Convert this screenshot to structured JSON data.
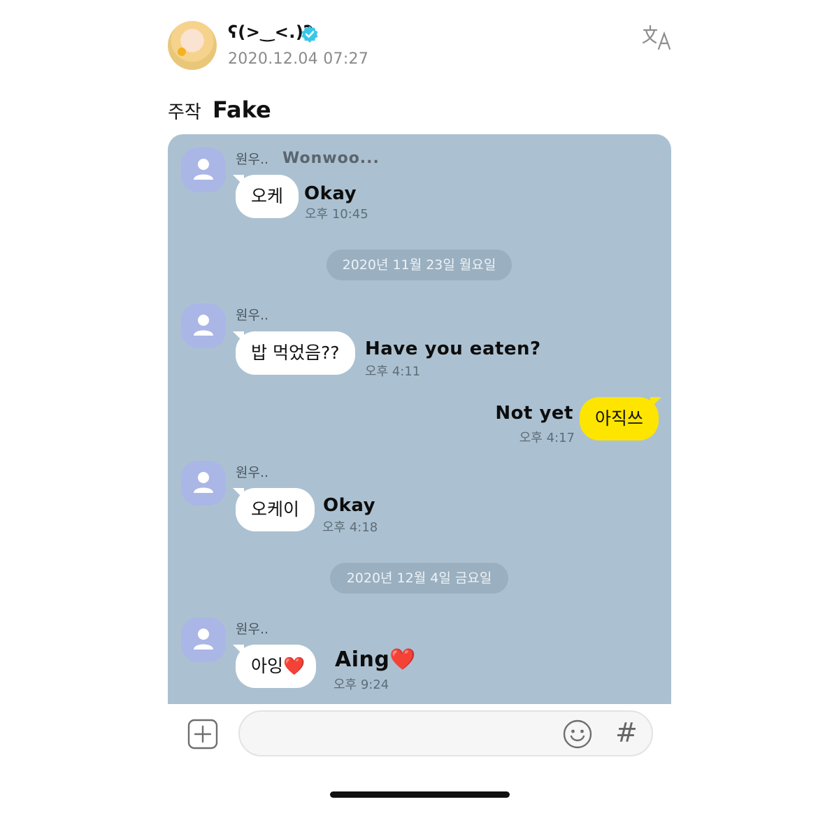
{
  "post": {
    "username": "ʕ(>‿<.)ʔ",
    "timestamp": "2020.12.04 07:27",
    "caption_ko": "주작",
    "caption_en": "Fake"
  },
  "chat": {
    "messages": [
      {
        "sender": "원우..",
        "sender_extra": "Wonwoo...",
        "text": "오케",
        "translation": "Okay",
        "time": "오후 10:45"
      },
      {
        "sender": "원우..",
        "text": "밥 먹었음??",
        "translation": "Have you eaten?",
        "time": "오후 4:11"
      },
      {
        "text": "아직쓰",
        "translation": "Not yet",
        "time": "오후 4:17"
      },
      {
        "sender": "원우..",
        "text": "오케이",
        "translation": "Okay",
        "time": "오후 4:18"
      },
      {
        "sender": "원우..",
        "text": "아잉",
        "translation": "Aing",
        "time": "오후 9:24"
      }
    ],
    "dates": [
      "2020년 11월 23일 월요일",
      "2020년 12월 4일 금요일"
    ],
    "heart_emoji": "❤️"
  },
  "input": {
    "add_icon": "plus-square-icon",
    "emoji_icon": "smiley-icon",
    "hash_label": "#"
  },
  "colors": {
    "chat_background": "#abc1d1",
    "my_bubble": "#fee500",
    "other_bubble": "#ffffff",
    "profile_placeholder": "#aab6e6",
    "verified_badge": "#3bc6e8"
  }
}
